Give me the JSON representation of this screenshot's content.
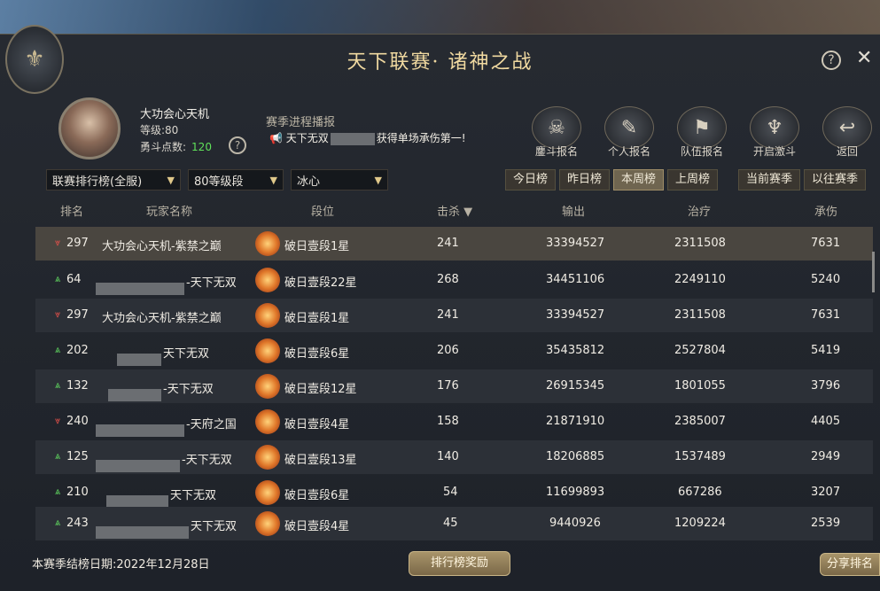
{
  "header": {
    "title": "天下联赛· 诸神之战",
    "help": "?",
    "close": "✕"
  },
  "player": {
    "name": "大功会心天机",
    "level_label": "等级:",
    "level": "80",
    "points_label": "勇斗点数:",
    "points": "120",
    "help": "?"
  },
  "broadcast": {
    "label": "赛季进程播报",
    "text_prefix": "天下无双",
    "text_suffix": "获得单场承伤第一!"
  },
  "actions": [
    {
      "label": "鏖斗报名",
      "icon": "demon-mask-icon"
    },
    {
      "label": "个人报名",
      "icon": "scroll-sword-icon"
    },
    {
      "label": "队伍报名",
      "icon": "flag-scroll-icon"
    },
    {
      "label": "开启激斗",
      "icon": "trident-emblem-icon"
    },
    {
      "label": "返回",
      "icon": "return-arrow-icon"
    }
  ],
  "filters": {
    "scope": "联赛排行榜(全服)",
    "grade": "80等级段",
    "school": "冰心"
  },
  "period_tabs": [
    "今日榜",
    "昨日榜",
    "本周榜",
    "上周榜"
  ],
  "active_period": "本周榜",
  "season_tabs": [
    "当前赛季",
    "以往赛季"
  ],
  "table": {
    "headers": {
      "rank": "排名",
      "player": "玩家名称",
      "tier": "段位",
      "kills": "击杀 ▼",
      "damage": "输出",
      "heal": "治疗",
      "tank": "承伤"
    },
    "rows": [
      {
        "trend": "down",
        "rank": "297",
        "name": "大功会心天机-紫禁之巅",
        "tier": "破日壹段1星",
        "kills": "241",
        "damage": "33394527",
        "heal": "2311508",
        "tank": "7631"
      },
      {
        "trend": "up",
        "rank": "64",
        "name": "-天下无双",
        "tier": "破日壹段22星",
        "kills": "268",
        "damage": "34451106",
        "heal": "2249110",
        "tank": "5240"
      },
      {
        "trend": "down",
        "rank": "297",
        "name": "大功会心天机-紫禁之巅",
        "tier": "破日壹段1星",
        "kills": "241",
        "damage": "33394527",
        "heal": "2311508",
        "tank": "7631"
      },
      {
        "trend": "up",
        "rank": "202",
        "name": "天下无双",
        "tier": "破日壹段6星",
        "kills": "206",
        "damage": "35435812",
        "heal": "2527804",
        "tank": "5419"
      },
      {
        "trend": "up",
        "rank": "132",
        "name": "-天下无双",
        "tier": "破日壹段12星",
        "kills": "176",
        "damage": "26915345",
        "heal": "1801055",
        "tank": "3796"
      },
      {
        "trend": "down",
        "rank": "240",
        "name": "-天府之国",
        "tier": "破日壹段4星",
        "kills": "158",
        "damage": "21871910",
        "heal": "2385007",
        "tank": "4405"
      },
      {
        "trend": "up",
        "rank": "125",
        "name": "-天下无双",
        "tier": "破日壹段13星",
        "kills": "140",
        "damage": "18206885",
        "heal": "1537489",
        "tank": "2949"
      },
      {
        "trend": "up",
        "rank": "210",
        "name": "天下无双",
        "tier": "破日壹段6星",
        "kills": "54",
        "damage": "11699893",
        "heal": "667286",
        "tank": "3207"
      },
      {
        "trend": "up",
        "rank": "243",
        "name": "天下无双",
        "tier": "破日壹段4星",
        "kills": "45",
        "damage": "9440926",
        "heal": "1209224",
        "tank": "2539"
      }
    ]
  },
  "footer": {
    "date_label": "本赛季结榜日期:2022年12月28日",
    "reward_button": "排行榜奖励",
    "share_button": "分享排名"
  }
}
